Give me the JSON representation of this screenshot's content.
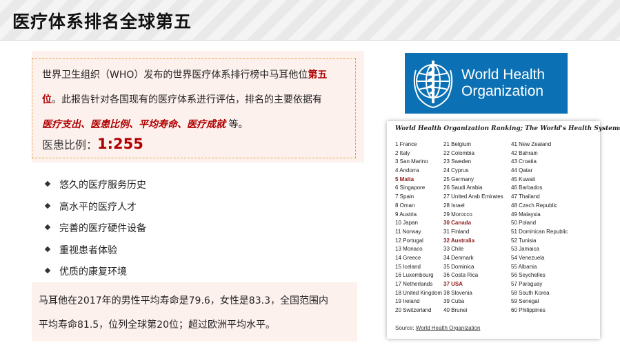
{
  "title": "医疗体系排名全球第五",
  "intro": {
    "line1_pre": "世界卫生组织（WHO）发布的世界医疗体系排行榜中马耳他位",
    "line1_red": "第五",
    "line2_red": "位",
    "line2_post": "。此报告针对各国现有的医疗体系进行评估，排名的主要依据有",
    "line3_red": "医疗支出、医患比例、平均寿命、医疗成就",
    "line3_post": " 等。",
    "ratio_label": "医患比例：",
    "ratio_value": "1:255"
  },
  "bullets": [
    "悠久的医疗服务历史",
    "高水平的医疗人才",
    "完善的医疗硬件设备",
    "重视患者体验",
    "优质的康复环境"
  ],
  "summary": {
    "line1": "马耳他在2017年的男性平均寿命是79.6，女性是83.3，全国范围内",
    "line2": "平均寿命81.5，位列全球第20位；超过欧洲平均水平。"
  },
  "who_logo": {
    "line1": "World Health",
    "line2": "Organization",
    "color": "#0b71b4"
  },
  "ranking": {
    "title": "World Health Organization Ranking; The World's Health Systems",
    "col1": [
      "1 France",
      "2 Italy",
      "3 San Marino",
      "4 Andorra",
      "5 Malta",
      "6 Singapore",
      "7 Spain",
      "8 Oman",
      "9 Austria",
      "10 Japan",
      "11 Norway",
      "12 Portugal",
      "13 Monaco",
      "14 Greece",
      "15 Iceland",
      "16 Luxembourg",
      "17 Netherlands",
      "18 United Kingdom",
      "19 Ireland",
      "20 Switzerland"
    ],
    "col2": [
      "21 Belgium",
      "22 Colombia",
      "23 Sweden",
      "24 Cyprus",
      "25 Germany",
      "26 Saudi Arabia",
      "27 United Arab Emirates",
      "28 Israel",
      "29 Morocco",
      "30 Canada",
      "31 Finland",
      "32 Australia",
      "33 Chile",
      "34 Denmark",
      "35 Dominica",
      "36 Costa Rica",
      "37 USA",
      "38 Slovenia",
      "39 Cuba",
      "40 Brunei"
    ],
    "col3": [
      "41 New Zealand",
      "42 Bahrain",
      "43 Croatia",
      "44 Qatar",
      "45 Kuwait",
      "46 Barbados",
      "47 Thailand",
      "48 Czech Republic",
      "49 Malaysia",
      "50 Poland",
      "51 Dominican Republic",
      "52 Tunisia",
      "53 Jamaica",
      "54 Venezuela",
      "55 Albania",
      "56 Seychelles",
      "57 Paraguay",
      "58 South Korea",
      "59 Senegal",
      "60 Philippines"
    ],
    "highlighted": [
      "5 Malta",
      "30 Canada",
      "32 Australia",
      "37 USA"
    ],
    "source_label": "Source: ",
    "source_link": "World Health Organization"
  },
  "colors": {
    "accent_red": "#b00000",
    "panel_bg": "#fdf1ee",
    "dashed_border": "#e8a040",
    "who_blue": "#0b71b4"
  }
}
